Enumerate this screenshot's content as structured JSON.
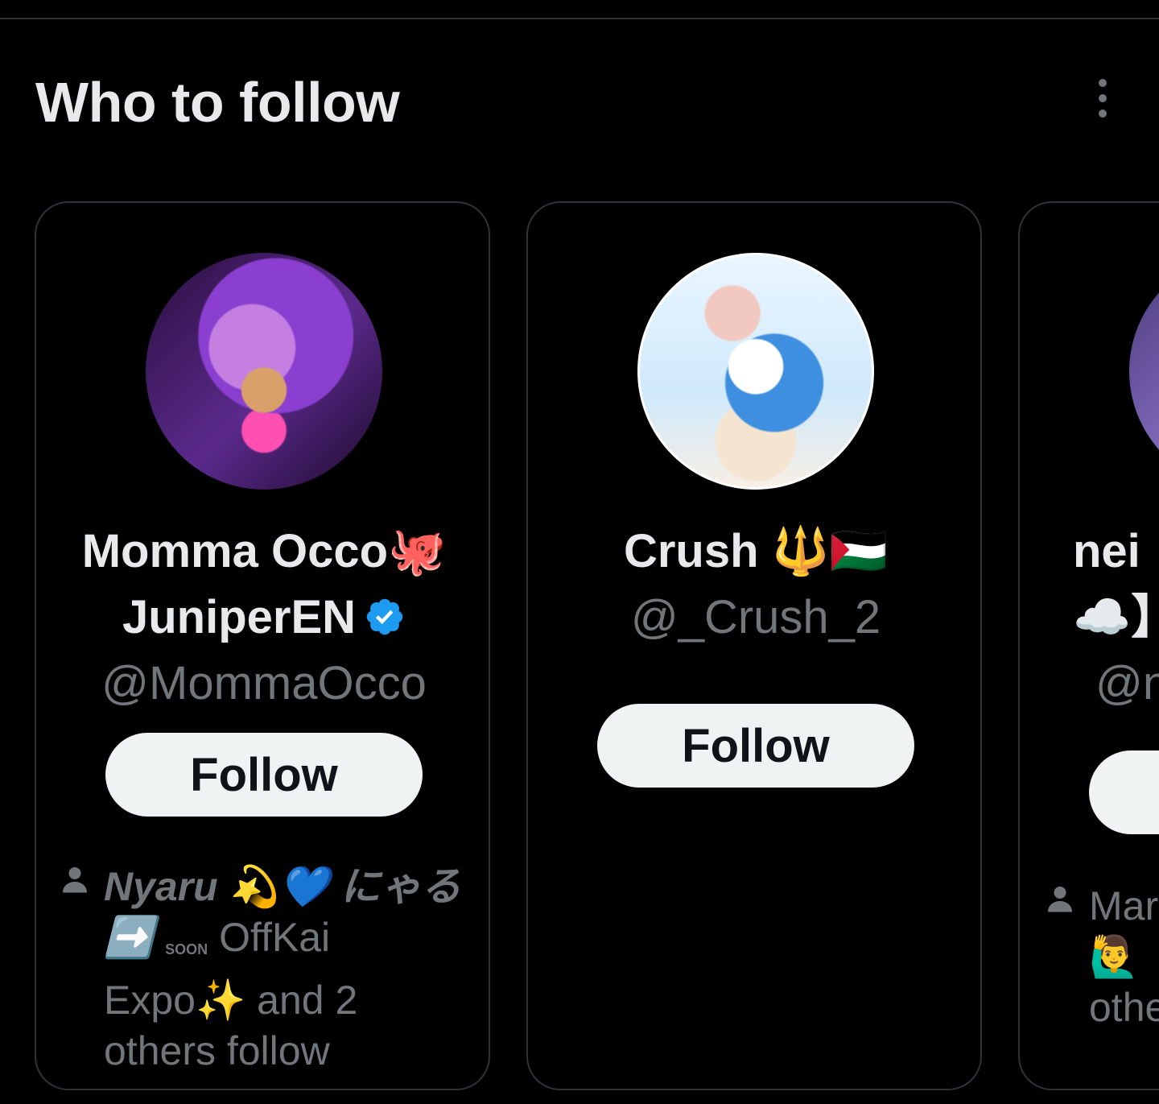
{
  "header": {
    "title": "Who to follow",
    "more_icon": "more-vertical-icon"
  },
  "cards": [
    {
      "display_name_line1": "Momma Occo🐙",
      "display_name_line2": "JuniperEN",
      "verified": true,
      "verified_color": "#1d9bf0",
      "handle": "@MommaOcco",
      "follow_label": "Follow",
      "social_name": "Nyaru 💫💙 にゃる ➡️",
      "social_badge": "SOON",
      "social_event": "OffKai Expo✨",
      "social_suffix": "and 2 others follow"
    },
    {
      "display_name_line1": "Crush 🔱🇵🇸",
      "handle": "@_Crush_2",
      "follow_label": "Follow"
    },
    {
      "display_name_line1": "nei",
      "display_name_line2": "☁️】",
      "handle": "@n",
      "social_text_line1": "Mar",
      "social_text_line2": "🙋‍♂️",
      "social_text_line3": "othe"
    }
  ],
  "colors": {
    "background": "#000000",
    "primary_text": "#e7e9ea",
    "secondary_text": "#71767b",
    "border": "#2f3336",
    "button_bg": "#eff3f4",
    "button_text": "#0f1419"
  }
}
